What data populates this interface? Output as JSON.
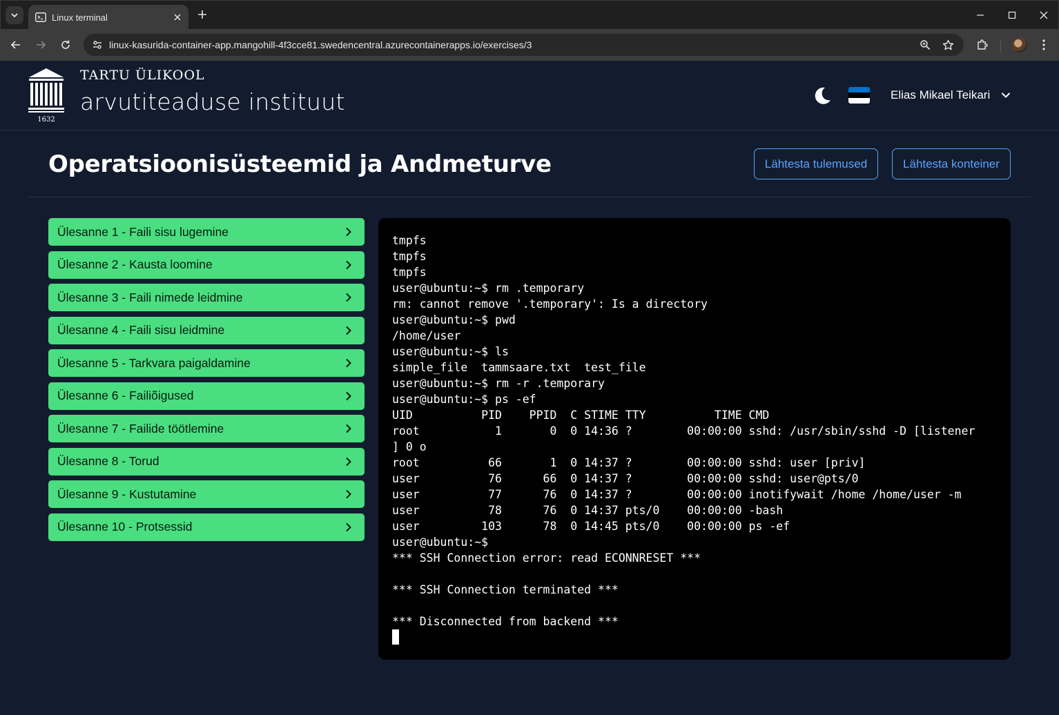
{
  "browser": {
    "tab_title": "Linux terminal",
    "url": "linux-kasurida-container-app.mangohill-4f3cce81.swedencentral.azurecontainerapps.io/exercises/3"
  },
  "header": {
    "university": "TARTU ÜLIKOOL",
    "institute": "arvutiteaduse instituut",
    "logo_year": "1632",
    "user_name": "Elias Mikael Teikari",
    "flag_colors": [
      "#0072ce",
      "#000000",
      "#ffffff"
    ]
  },
  "page": {
    "title": "Operatsioonisüsteemid ja Andmeturve",
    "restart_results_label": "Lähtesta tulemused",
    "restart_container_label": "Lähtesta konteiner"
  },
  "tasks": [
    {
      "label": "Ülesanne 1 - Faili sisu lugemine"
    },
    {
      "label": "Ülesanne 2 - Kausta loomine"
    },
    {
      "label": "Ülesanne 3 - Faili nimede leidmine"
    },
    {
      "label": "Ülesanne 4 - Faili sisu leidmine"
    },
    {
      "label": "Ülesanne 5 - Tarkvara paigaldamine"
    },
    {
      "label": "Ülesanne 6 - Failiõigused"
    },
    {
      "label": "Ülesanne 7 - Failide töötlemine"
    },
    {
      "label": "Ülesanne 8 - Torud"
    },
    {
      "label": "Ülesanne 9 - Kustutamine"
    },
    {
      "label": "Ülesanne 10 - Protsessid"
    }
  ],
  "terminal": {
    "lines": [
      "tmpfs",
      "tmpfs",
      "tmpfs",
      "user@ubuntu:~$ rm .temporary",
      "rm: cannot remove '.temporary': Is a directory",
      "user@ubuntu:~$ pwd",
      "/home/user",
      "user@ubuntu:~$ ls",
      "simple_file  tammsaare.txt  test_file",
      "user@ubuntu:~$ rm -r .temporary",
      "user@ubuntu:~$ ps -ef",
      "UID          PID    PPID  C STIME TTY          TIME CMD",
      "root           1       0  0 14:36 ?        00:00:00 sshd: /usr/sbin/sshd -D [listener",
      "] 0 o",
      "root          66       1  0 14:37 ?        00:00:00 sshd: user [priv]",
      "user          76      66  0 14:37 ?        00:00:00 sshd: user@pts/0",
      "user          77      76  0 14:37 ?        00:00:00 inotifywait /home /home/user -m",
      "user          78      76  0 14:37 pts/0    00:00:00 -bash",
      "user         103      78  0 14:45 pts/0    00:00:00 ps -ef",
      "user@ubuntu:~$",
      "*** SSH Connection error: read ECONNRESET ***",
      "",
      "*** SSH Connection terminated ***",
      "",
      "*** Disconnected from backend ***"
    ]
  },
  "colors": {
    "background": "#131c2e",
    "task_green": "#4ade80",
    "accent_blue": "#5aa3ff",
    "terminal_bg": "#000000"
  }
}
